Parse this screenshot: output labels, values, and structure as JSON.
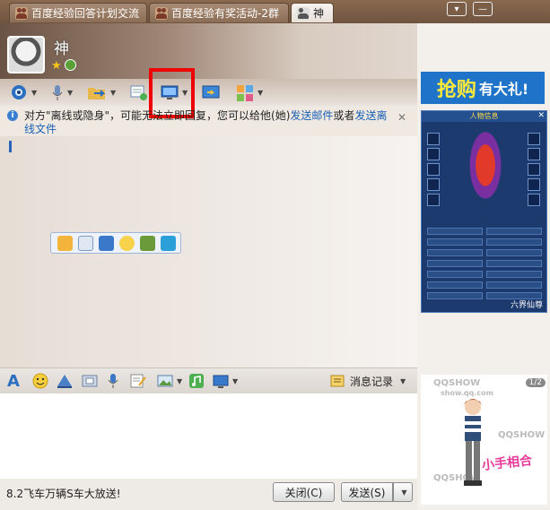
{
  "tabs": [
    {
      "label": "百度经验回答计划交流",
      "active": false
    },
    {
      "label": "百度经验有奖活动-2群",
      "active": false
    },
    {
      "label": "神",
      "active": true
    }
  ],
  "window_controls": [
    "menu-icon",
    "minimize-icon"
  ],
  "contact": {
    "name": "神"
  },
  "notice": {
    "prefix": "对方\"离线或隐身\"，可能无法立即回复，您可以给他(她)",
    "link1": "发送邮件",
    "mid": "或者",
    "link2": "发送离线文件"
  },
  "input_toolbar": {
    "history_label": "消息记录"
  },
  "bottom": {
    "marquee": "8.2飞车万辆S车大放送!",
    "close_label": "关闭(C)",
    "send_label": "发送(S)"
  },
  "ads": {
    "top_big": "抢购",
    "top_small": "有大礼!",
    "char_title": "人物信息",
    "char_label": "六界仙尊",
    "show_watermark": "QQSHOW",
    "show_domain": "show.qq.com",
    "show_count": "1/2",
    "show_text": "小手相合"
  },
  "colors": {
    "accent": "#1f74c9",
    "highlight": "#ee0000",
    "link": "#1a5fb4"
  }
}
